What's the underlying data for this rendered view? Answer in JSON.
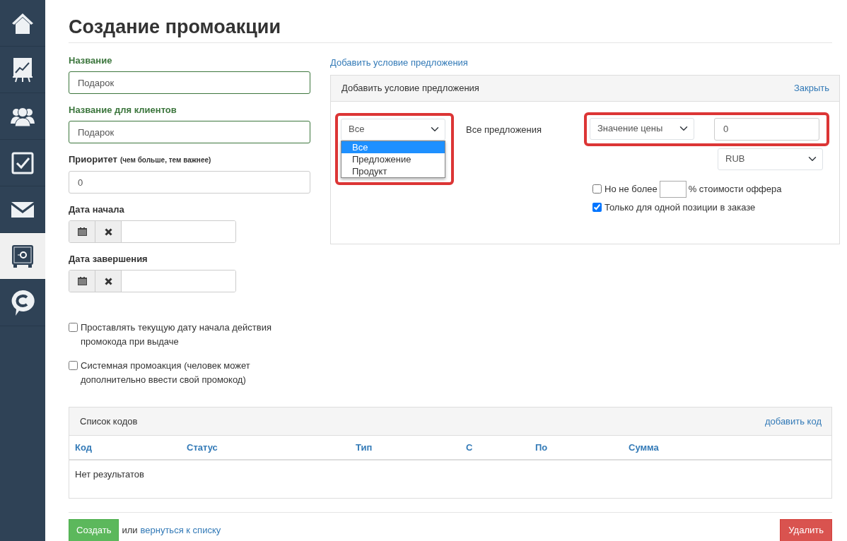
{
  "sidebar": {
    "items": [
      {
        "selected": false
      },
      {
        "selected": false
      },
      {
        "selected": false
      },
      {
        "selected": false
      },
      {
        "selected": false
      },
      {
        "selected": true
      },
      {
        "selected": false
      }
    ]
  },
  "page_title": "Создание промоакции",
  "form": {
    "fields": [
      {
        "kind": "text",
        "label": "Название",
        "value": "Подарок",
        "valid": true
      },
      {
        "kind": "text",
        "label": "Название для клиентов",
        "value": "Подарок",
        "valid": true
      },
      {
        "kind": "text",
        "label": "Приоритет",
        "hint": "(чем больше, тем важнее)",
        "value": "0",
        "valid": false
      },
      {
        "kind": "date",
        "label": "Дата начала"
      },
      {
        "kind": "date",
        "label": "Дата завершения"
      }
    ],
    "checkboxes": [
      {
        "label": "Проставлять текущую дату начала действия промокода при выдаче",
        "checked": false
      },
      {
        "label": "Системная промоакция (человек может дополнительно ввести свой промокод)",
        "checked": false
      }
    ]
  },
  "conditions": {
    "link": "Добавить условие предложения",
    "panel": {
      "title": "Добавить условие предложения",
      "close": "Закрыть",
      "scope_select": {
        "value": "Все",
        "open": true,
        "highlighted": true,
        "options": [
          {
            "label": "Все",
            "selected": true
          },
          {
            "label": "Предложение",
            "selected": false
          },
          {
            "label": "Продукт",
            "selected": false
          }
        ]
      },
      "scope_text": "Все предложения",
      "price": {
        "highlighted": true,
        "type_select": "Значение цены",
        "value": "0"
      },
      "currency_select": "RUB",
      "limit": {
        "label_before": "Но не более",
        "label_after": "% стоимости оффера",
        "checked": false
      },
      "single": {
        "label": "Только для одной позиции в заказе",
        "checked": true
      }
    }
  },
  "codes": {
    "title": "Список кодов",
    "add_link": "добавить код",
    "columns": [
      "Код",
      "Статус",
      "Тип",
      "С",
      "По",
      "Сумма"
    ],
    "empty_text": "Нет результатов"
  },
  "footer": {
    "create_button": "Создать",
    "or_text": "или",
    "back_link": "вернуться к списку",
    "delete_button": "Удалить"
  }
}
